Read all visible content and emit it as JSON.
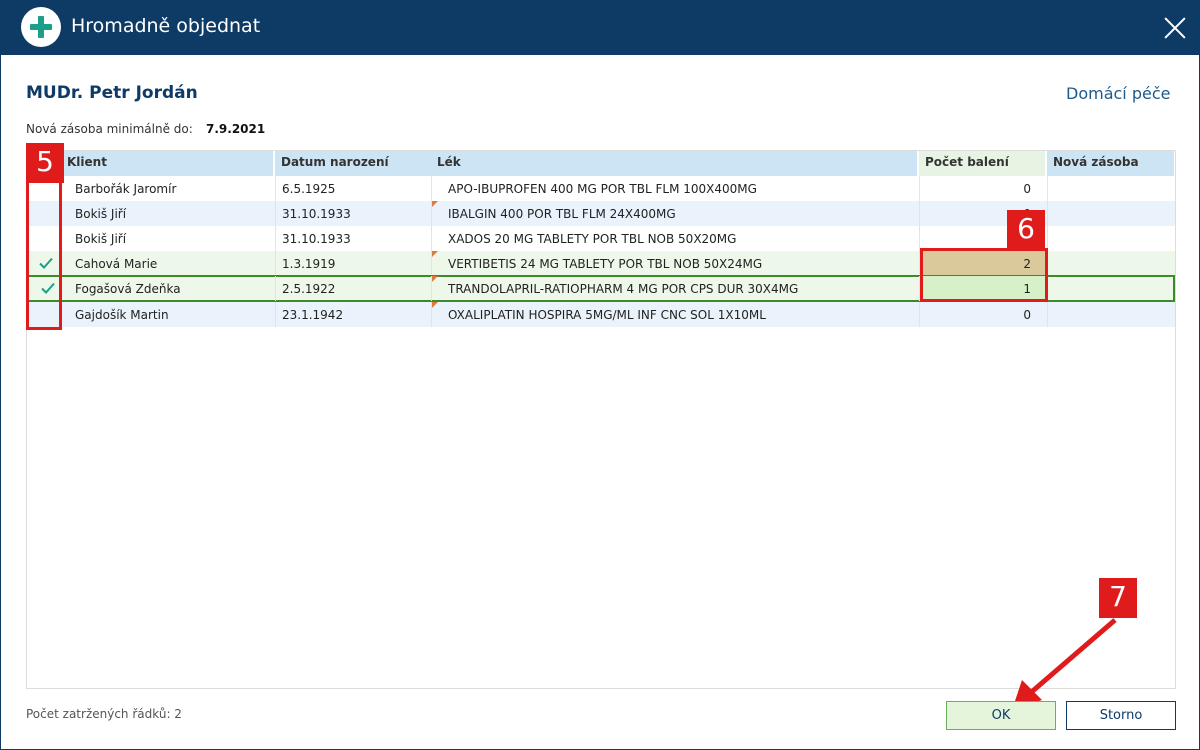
{
  "window": {
    "title": "Hromadně objednat",
    "close_icon": "close-icon",
    "app_icon": "plus-icon"
  },
  "header": {
    "doctor": "MUDr. Petr Jordán",
    "service": "Domácí péče",
    "stock_label": "Nová zásoba minimálně do:",
    "stock_date": "7.9.2021"
  },
  "table": {
    "columns": {
      "klient": "Klient",
      "datum": "Datum narození",
      "lek": "Lék",
      "pocet": "Počet balení",
      "nova": "Nová zásoba"
    },
    "sort_icon": "sort-asc-icon",
    "rows": [
      {
        "checked": false,
        "klient": "Barbořák Jaromír",
        "datum": "6.5.1925",
        "lek": "APO-IBUPROFEN 400 MG POR TBL FLM 100X400MG",
        "pocet": "0",
        "nova": ""
      },
      {
        "checked": false,
        "klient": "Bokiš Jiří",
        "datum": "31.10.1933",
        "lek": "IBALGIN 400 POR TBL FLM 24X400MG",
        "pocet": "0",
        "nova": ""
      },
      {
        "checked": false,
        "klient": "Bokiš Jiří",
        "datum": "31.10.1933",
        "lek": "XADOS 20 MG TABLETY POR TBL NOB 50X20MG",
        "pocet": "0",
        "nova": ""
      },
      {
        "checked": true,
        "klient": "Cahová Marie",
        "datum": "1.3.1919",
        "lek": "VERTIBETIS 24 MG TABLETY POR TBL NOB 50X24MG",
        "pocet": "2",
        "nova": ""
      },
      {
        "checked": true,
        "klient": "Fogašová Zdeňka",
        "datum": "2.5.1922",
        "lek": "TRANDOLAPRIL-RATIOPHARM 4 MG POR CPS DUR 30X4MG",
        "pocet": "1",
        "nova": ""
      },
      {
        "checked": false,
        "klient": "Gajdošík Martin",
        "datum": "23.1.1942",
        "lek": "OXALIPLATIN HOSPIRA 5MG/ML INF CNC SOL 1X10ML",
        "pocet": "0",
        "nova": ""
      }
    ]
  },
  "annotations": {
    "step5": "5",
    "step6": "6",
    "step7": "7",
    "color": "#e01b1b"
  },
  "footer": {
    "count_label": "Počet zatržených řádků: 2",
    "ok_label": "OK",
    "cancel_label": "Storno"
  },
  "colors": {
    "titlebar": "#0e3b66",
    "accent": "#1aa08a",
    "header_row": "#cde4f5",
    "check": "#1aa08a"
  }
}
